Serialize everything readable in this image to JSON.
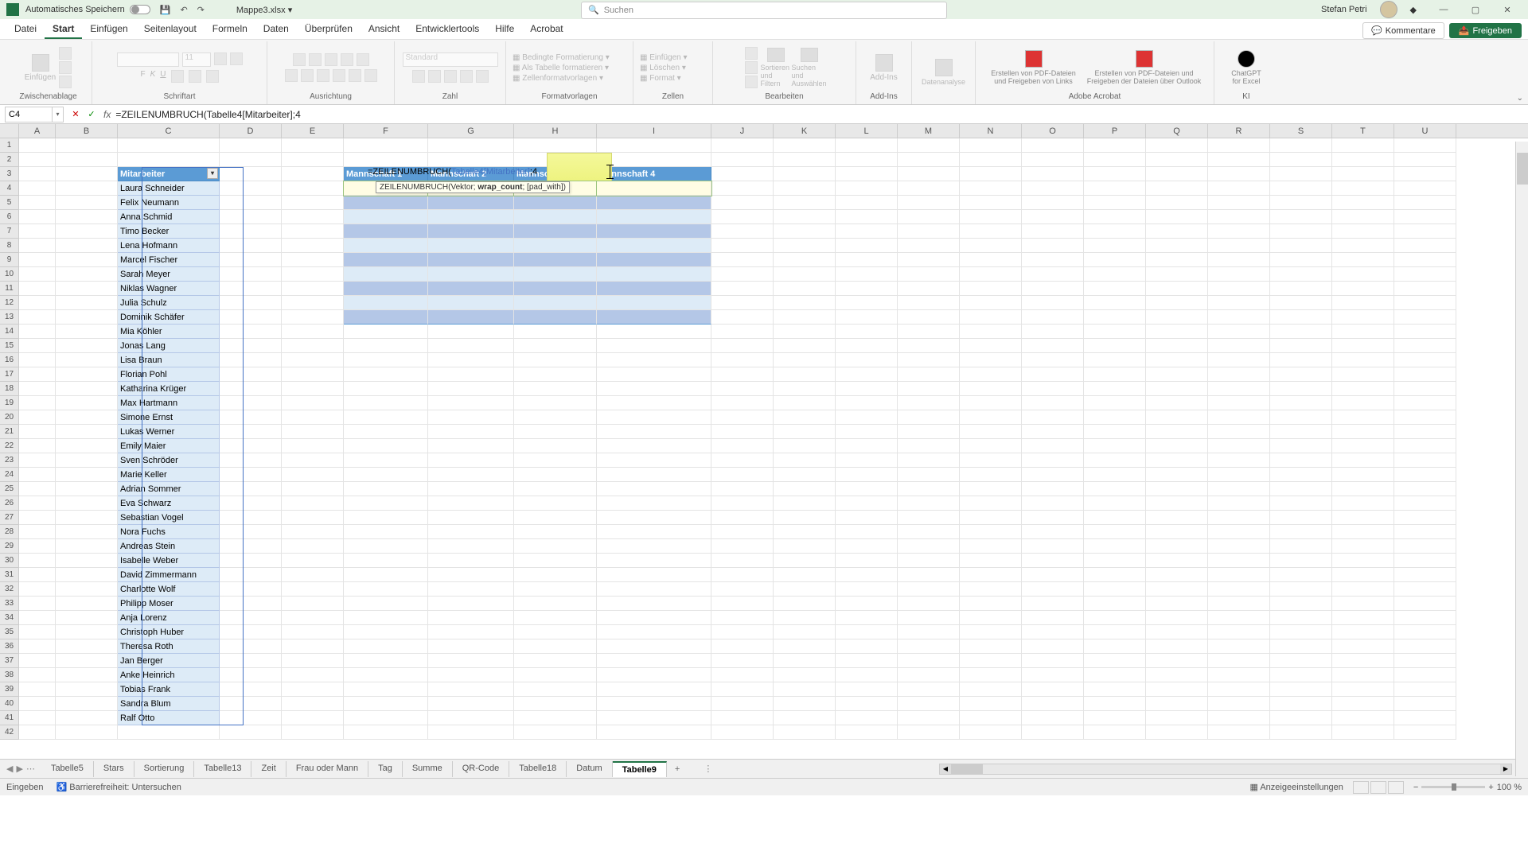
{
  "titlebar": {
    "autosave": "Automatisches Speichern",
    "filename": "Mappe3.xlsx",
    "search_placeholder": "Suchen",
    "username": "Stefan Petri"
  },
  "menu": {
    "tabs": [
      "Datei",
      "Start",
      "Einfügen",
      "Seitenlayout",
      "Formeln",
      "Daten",
      "Überprüfen",
      "Ansicht",
      "Entwicklertools",
      "Hilfe",
      "Acrobat"
    ],
    "active": 1,
    "comments": "Kommentare",
    "share": "Freigeben"
  },
  "ribbon": {
    "groups": {
      "clipboard": "Zwischenablage",
      "paste": "Einfügen",
      "font": "Schriftart",
      "alignment": "Ausrichtung",
      "number": "Zahl",
      "number_format": "Standard",
      "styles": "Formatvorlagen",
      "cond_fmt": "Bedingte Formatierung",
      "as_table": "Als Tabelle formatieren",
      "cell_styles": "Zellenformatvorlagen",
      "cells": "Zellen",
      "insert": "Einfügen",
      "delete": "Löschen",
      "format": "Format",
      "editing": "Bearbeiten",
      "sort": "Sortieren und Filtern",
      "find": "Suchen und Auswählen",
      "addins": "Add-Ins",
      "addins_btn": "Add-Ins",
      "analysis": "Datenanalyse",
      "acrobat": "Adobe Acrobat",
      "pdf1": "Erstellen von PDF-Dateien und Freigeben von Links",
      "pdf2": "Erstellen von PDF-Dateien und Freigeben der Dateien über Outlook",
      "ai": "KI",
      "gpt": "ChatGPT for Excel"
    }
  },
  "formulabar": {
    "cell_ref": "C4",
    "formula": "=ZEILENUMBRUCH(Tabelle4[Mitarbeiter];4"
  },
  "columns": [
    "A",
    "B",
    "C",
    "D",
    "E",
    "F",
    "G",
    "H",
    "I",
    "J",
    "K",
    "L",
    "M",
    "N",
    "O",
    "P",
    "Q",
    "R",
    "S",
    "T",
    "U"
  ],
  "table": {
    "header": "Mitarbeiter",
    "rows": [
      "Laura Schneider",
      "Felix Neumann",
      "Anna Schmid",
      "Timo Becker",
      "Lena Hofmann",
      "Marcel Fischer",
      "Sarah Meyer",
      "Niklas Wagner",
      "Julia Schulz",
      "Dominik Schäfer",
      "Mia Köhler",
      "Jonas Lang",
      "Lisa Braun",
      "Florian Pohl",
      "Katharina Krüger",
      "Max Hartmann",
      "Simone Ernst",
      "Lukas Werner",
      "Emily Maier",
      "Sven Schröder",
      "Marie Keller",
      "Adrian Sommer",
      "Eva Schwarz",
      "Sebastian Vogel",
      "Nora Fuchs",
      "Andreas Stein",
      "Isabelle Weber",
      "David Zimmermann",
      "Charlotte Wolf",
      "Philipp Moser",
      "Anja Lorenz",
      "Christoph Huber",
      "Theresa Roth",
      "Jan Berger",
      "Anke Heinrich",
      "Tobias Frank",
      "Sandra Blum",
      "Ralf Otto"
    ]
  },
  "mannschaft": {
    "headers": [
      "Mannschaft 1",
      "Mannschaft 2",
      "Mannschaft 3",
      "Mannschaft 4"
    ]
  },
  "formula_cell": {
    "prefix": "=ZEILENUMBRUCH(",
    "ref": "Tabelle4[Mitarbeiter]",
    "suffix": ";4"
  },
  "tooltip": {
    "fn": "ZEILENUMBRUCH(",
    "p1": "Vektor; ",
    "p2": "wrap_count",
    "p3": "; [pad_with])"
  },
  "sheets": {
    "tabs": [
      "Tabelle5",
      "Stars",
      "Sortierung",
      "Tabelle13",
      "Zeit",
      "Frau oder Mann",
      "Tag",
      "Summe",
      "QR-Code",
      "Tabelle18",
      "Datum",
      "Tabelle9"
    ],
    "active": 11
  },
  "statusbar": {
    "mode": "Eingeben",
    "accessibility": "Barrierefreiheit: Untersuchen",
    "display_settings": "Anzeigeeinstellungen",
    "zoom": "100 %"
  }
}
